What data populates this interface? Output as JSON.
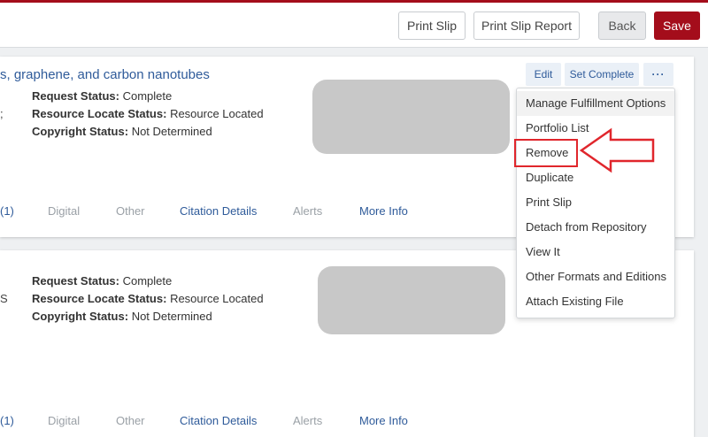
{
  "toolbar": {
    "print_slip": "Print Slip",
    "print_slip_report": "Print Slip Report",
    "back": "Back",
    "save": "Save"
  },
  "colors": {
    "accent": "#a40d1b",
    "link": "#2f5b9a",
    "highlight": "#e0262c"
  },
  "requests": [
    {
      "title": "s, graphene, and carbon nanotubes",
      "prefix": ";",
      "request_status_label": "Request Status:",
      "request_status": "Complete",
      "resource_locate_label": "Resource Locate Status:",
      "resource_locate": "Resource Located",
      "copyright_label": "Copyright Status:",
      "copyright": "Not Determined",
      "tabs": [
        "(1)",
        "Digital",
        "Other",
        "Citation Details",
        "Alerts",
        "More Info"
      ]
    },
    {
      "title": "",
      "prefix": "S",
      "request_status_label": "Request Status:",
      "request_status": "Complete",
      "resource_locate_label": "Resource Locate Status:",
      "resource_locate": "Resource Located",
      "copyright_label": "Copyright Status:",
      "copyright": "Not Determined",
      "tabs": [
        "(1)",
        "Digital",
        "Other",
        "Citation Details",
        "Alerts",
        "More Info"
      ]
    }
  ],
  "card_actions": {
    "edit": "Edit",
    "set_complete": "Set Complete",
    "more": "···"
  },
  "menu": {
    "items": [
      "Manage Fulfillment Options",
      "Portfolio List",
      "Remove",
      "Duplicate",
      "Print Slip",
      "Detach from Repository",
      "View It",
      "Other Formats and Editions",
      "Attach Existing File"
    ]
  }
}
